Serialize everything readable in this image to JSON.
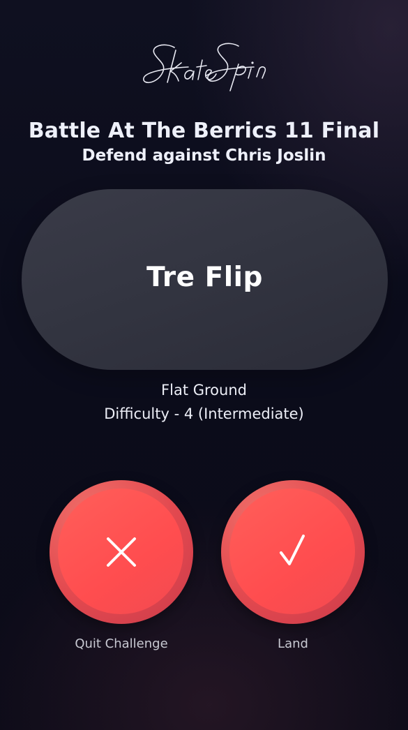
{
  "brand": {
    "logo_text": "Skate Spin"
  },
  "challenge": {
    "title": "Battle At The Berrics 11 Final",
    "subtitle": "Defend against Chris Joslin"
  },
  "trick": {
    "name": "Tre Flip",
    "location": "Flat Ground",
    "difficulty": "Difficulty - 4 (Intermediate)"
  },
  "actions": {
    "quit": {
      "label": "Quit Challenge",
      "icon": "close-icon"
    },
    "land": {
      "label": "Land",
      "icon": "check-icon"
    }
  },
  "colors": {
    "button_red": "#ff4d4f",
    "card_gray": "#353643",
    "background": "#0c0d1c"
  }
}
